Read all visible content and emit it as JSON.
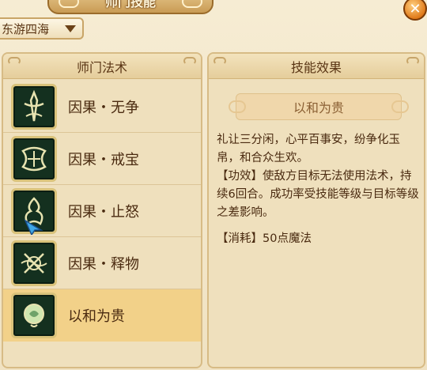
{
  "window": {
    "title": "师门技能",
    "close_icon": "close-icon"
  },
  "region": {
    "selected": "东游四海"
  },
  "left_panel": {
    "header": "师门法术",
    "skills": [
      {
        "name": "因果・无争",
        "icon": "sword-rune-icon"
      },
      {
        "name": "因果・戒宝",
        "icon": "knot-rune-icon"
      },
      {
        "name": "因果・止怒",
        "icon": "flame-rune-icon"
      },
      {
        "name": "因果・释物",
        "icon": "scroll-rune-icon"
      },
      {
        "name": "以和为贵",
        "icon": "harmony-icon",
        "selected": true
      }
    ]
  },
  "right_panel": {
    "header": "技能效果",
    "skill_title": "以和为贵",
    "description": "礼让三分闲，心平百事安，纷争化玉帛，和合众生欢。",
    "effect": "【功效】使敌方目标无法使用法术，持续6回合。成功率受技能等级与目标等级之差影响。",
    "cost": "【消耗】50点魔法"
  },
  "colors": {
    "background": "#f3e7c9",
    "active_row": "#f2d189",
    "text": "#4a2a10",
    "icon_bg": "#14301f"
  }
}
